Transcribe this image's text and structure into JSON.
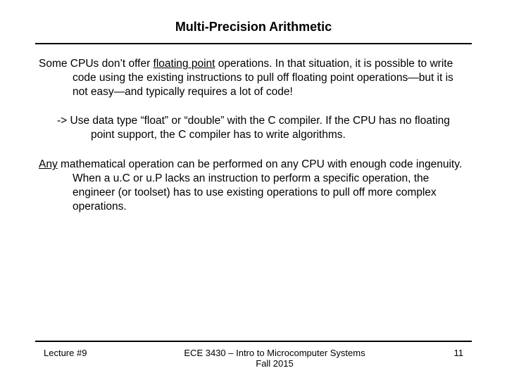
{
  "title": "Multi-Precision Arithmetic",
  "body": {
    "p1_a": "Some CPUs don’t offer ",
    "p1_u": "floating point",
    "p1_b": " operations.  In that situation, it is possible to write code using the existing instructions to pull off floating point operations—but it is not easy—and typically requires a lot of code!",
    "p2": "-> Use data type “float” or “double” with the C compiler.  If the CPU has no floating point support, the C compiler has to write algorithms.",
    "p3_u": "Any",
    "p3_b": " mathematical operation can be performed on any CPU with enough code ingenuity.  When a u.C or u.P lacks an instruction to perform a specific operation, the engineer (or toolset) has to use existing operations to pull off more complex operations."
  },
  "footer": {
    "left": "Lecture #9",
    "center_line1": "ECE 3430 – Intro to Microcomputer Systems",
    "center_line2": "Fall 2015",
    "right": "11"
  }
}
